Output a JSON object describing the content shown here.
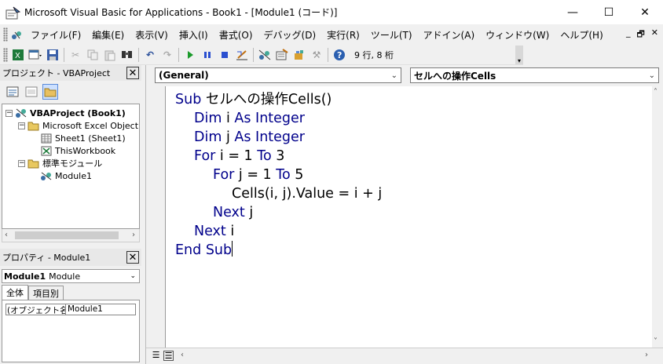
{
  "window": {
    "title": "Microsoft Visual Basic for Applications - Book1 - [Module1 (コード)]",
    "controls": {
      "minimize": "—",
      "maximize": "☐",
      "close": "✕"
    }
  },
  "menu": {
    "items": [
      "ファイル(F)",
      "編集(E)",
      "表示(V)",
      "挿入(I)",
      "書式(O)",
      "デバッグ(D)",
      "実行(R)",
      "ツール(T)",
      "アドイン(A)",
      "ウィンドウ(W)",
      "ヘルプ(H)"
    ],
    "mdi": {
      "minimize": "_",
      "restore": "🗗",
      "close": "✕"
    }
  },
  "toolbar": {
    "position_text": "9 行, 8 桁"
  },
  "project_pane": {
    "title": "プロジェクト - VBAProject",
    "close": "✕",
    "tree": {
      "root": "VBAProject (Book1)",
      "folder_objects": "Microsoft Excel Object",
      "sheet1": "Sheet1 (Sheet1)",
      "workbook": "ThisWorkbook",
      "folder_modules": "標準モジュール",
      "module1": "Module1"
    }
  },
  "properties_pane": {
    "title": "プロパティ - Module1",
    "close": "✕",
    "selector_bold": "Module1",
    "selector_type": "Module",
    "tabs": [
      "全体",
      "項目別"
    ],
    "rows": [
      {
        "key": "(オブジェクト名)",
        "value": "Module1"
      }
    ]
  },
  "code_window": {
    "object_combo": "(General)",
    "procedure_combo": "セルへの操作Cells",
    "lines": [
      {
        "kw": "Sub",
        "rest": " セルへの操作Cells()"
      },
      {
        "kw": "Dim",
        "rest": " i ",
        "kw2": "As Integer"
      },
      {
        "kw": "Dim",
        "rest": " j ",
        "kw2": "As Integer"
      },
      {
        "kw": "For",
        "rest": " i = 1 ",
        "kw2": "To",
        "rest2": " 3"
      },
      {
        "kw": "For",
        "rest": " j = 1 ",
        "kw2": "To",
        "rest2": " 5"
      },
      {
        "kw": "",
        "rest": "Cells(i, j).Value = i + j"
      },
      {
        "kw": "Next",
        "rest": " j"
      },
      {
        "kw": "Next",
        "rest": " i"
      },
      {
        "kw": "End Sub",
        "rest": ""
      }
    ]
  },
  "colors": {
    "keyword": "#00008b",
    "selection_border": "#5a8ad8"
  }
}
